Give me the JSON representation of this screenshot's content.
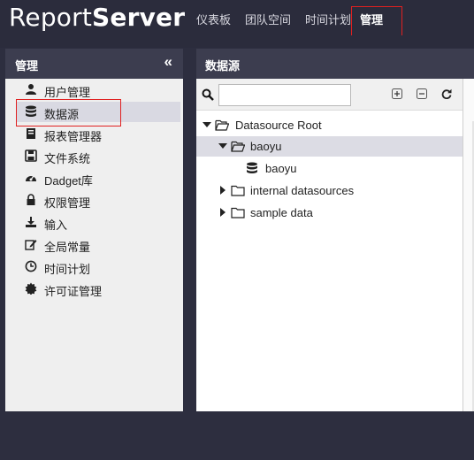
{
  "app": {
    "logo_light": "Report",
    "logo_bold": "Server"
  },
  "topnav": [
    {
      "label": "仪表板"
    },
    {
      "label": "团队空间"
    },
    {
      "label": "时间计划"
    },
    {
      "label": "管理"
    }
  ],
  "left_panel": {
    "title": "管理",
    "collapse_glyph": "«",
    "items": [
      {
        "label": "用户管理",
        "icon": "user-icon"
      },
      {
        "label": "数据源",
        "icon": "database-icon"
      },
      {
        "label": "报表管理器",
        "icon": "book-icon"
      },
      {
        "label": "文件系统",
        "icon": "floppy-icon"
      },
      {
        "label": "Dadget库",
        "icon": "dashboard-gauge-icon"
      },
      {
        "label": "权限管理",
        "icon": "lock-icon"
      },
      {
        "label": "输入",
        "icon": "download-icon"
      },
      {
        "label": "全局常量",
        "icon": "edit-icon"
      },
      {
        "label": "时间计划",
        "icon": "clock-icon"
      },
      {
        "label": "许可证管理",
        "icon": "certificate-icon"
      }
    ]
  },
  "right_panel": {
    "title": "数据源",
    "search": {
      "value": "",
      "placeholder": ""
    },
    "tree": [
      {
        "label": "Datasource Root"
      },
      {
        "label": "baoyu"
      },
      {
        "label": "baoyu"
      },
      {
        "label": "internal datasources"
      },
      {
        "label": "sample data"
      }
    ]
  },
  "colors": {
    "header_bg": "#2b2c3c",
    "panel_header_bg": "#3c3d4f",
    "highlight_border": "#e02020",
    "selected_row": "#dcdce4"
  }
}
